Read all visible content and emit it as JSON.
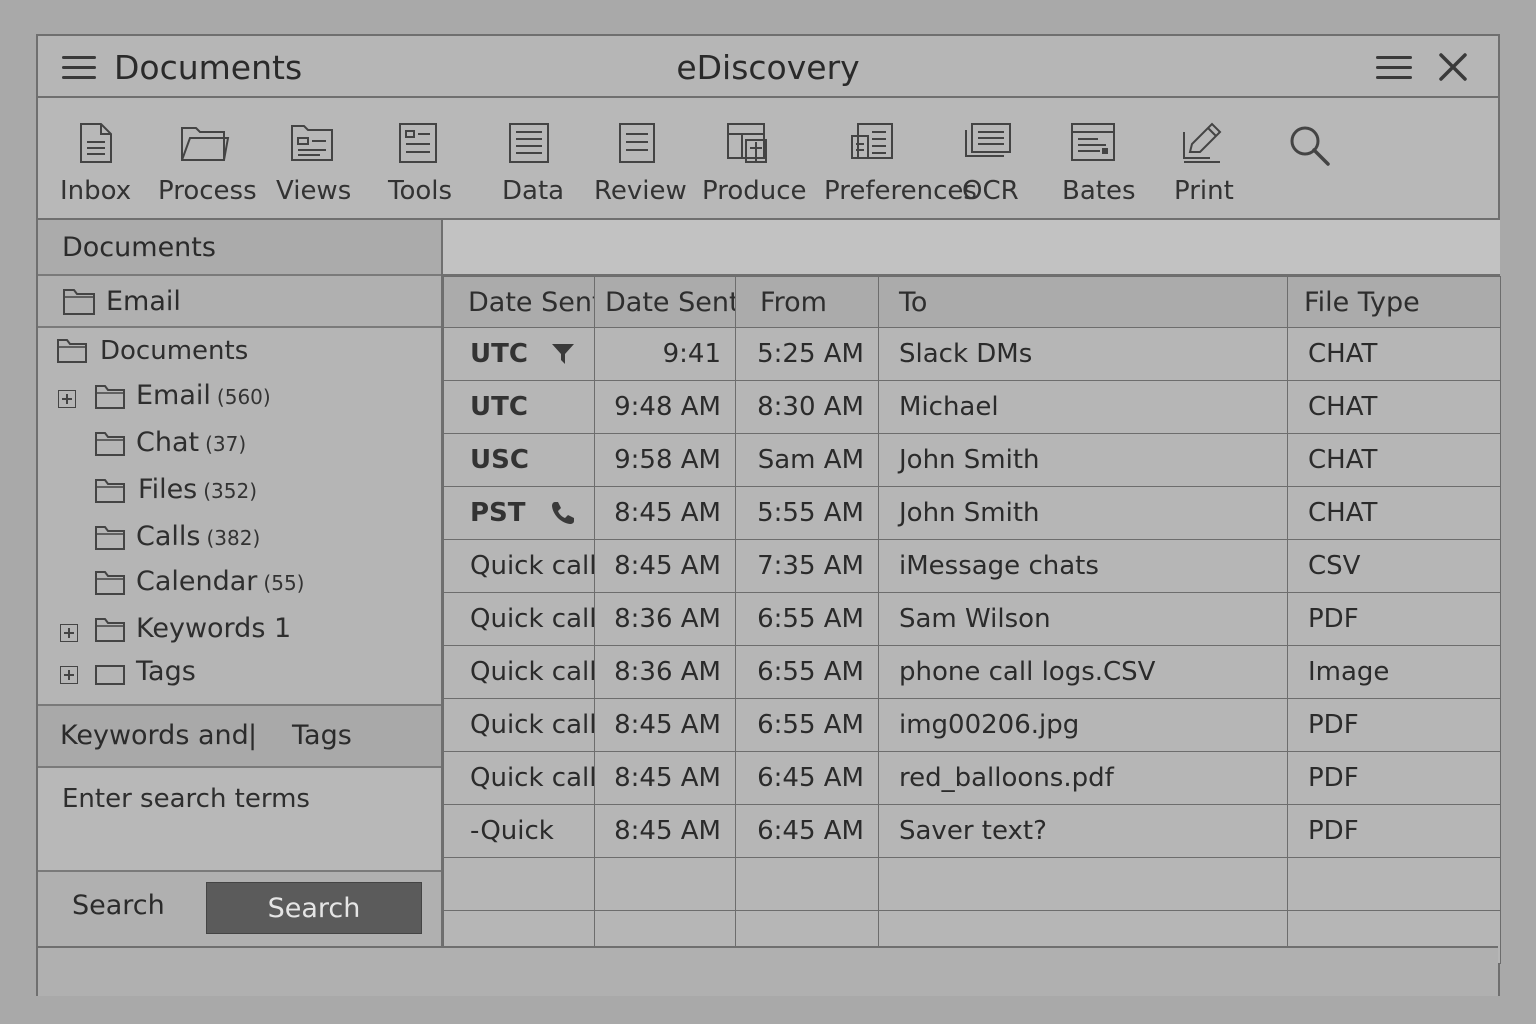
{
  "window": {
    "left_title": "Documents",
    "center_title": "eDiscovery"
  },
  "toolbar": [
    {
      "label": "Inbox",
      "icon": "document-icon"
    },
    {
      "label": "Process",
      "icon": "folder-icon"
    },
    {
      "label": "Views",
      "icon": "views-icon"
    },
    {
      "label": "Tools",
      "icon": "tools-icon"
    },
    {
      "label": "Data",
      "icon": "data-icon"
    },
    {
      "label": "Review",
      "icon": "review-icon"
    },
    {
      "label": "Produce",
      "icon": "produce-icon"
    },
    {
      "label": "Preferences",
      "icon": "preferences-icon"
    },
    {
      "label": "OCR",
      "icon": "ocr-icon"
    },
    {
      "label": "Bates",
      "icon": "bates-icon"
    },
    {
      "label": "Print",
      "icon": "print-icon"
    },
    {
      "label": "",
      "icon": "search-icon"
    }
  ],
  "left": {
    "header": "Documents",
    "email_section": "Email",
    "tree": {
      "root": "Documents",
      "items": [
        {
          "label": "Email",
          "count": "(560)"
        },
        {
          "label": "Chat",
          "count": "(37)"
        },
        {
          "label": "Files",
          "count": "(352)"
        },
        {
          "label": "Calls",
          "count": "(382)"
        },
        {
          "label": "Calendar",
          "count": "(55)"
        },
        {
          "label": "Keywords 1",
          "count": ""
        },
        {
          "label": "Tags",
          "count": ""
        }
      ]
    },
    "keywords_tab": "Keywords and",
    "separator": "|",
    "tags_tab": "Tags",
    "search_placeholder": "Enter search terms",
    "search_label": "Search",
    "search_button": "Search"
  },
  "grid": {
    "columns": [
      "Date Sent",
      "Date Sent",
      "From",
      "To",
      "File Type"
    ],
    "rows": [
      {
        "a": "UTC",
        "b": "9:41",
        "c": "5:25 AM",
        "d": "Slack DMs",
        "e": "CHAT"
      },
      {
        "a": "UTC",
        "b": "9:48 AM",
        "c": "8:30 AM",
        "d": "Michael",
        "e": "CHAT"
      },
      {
        "a": "USC",
        "b": "9:58 AM",
        "c": "Sam AM",
        "d": "John Smith",
        "e": "CHAT"
      },
      {
        "a": "PST",
        "b": "8:45 AM",
        "c": "5:55 AM",
        "d": "John Smith",
        "e": "CHAT"
      },
      {
        "a": "Quick call",
        "b": "8:45 AM",
        "c": "7:35 AM",
        "d": "iMessage chats",
        "e": "CSV"
      },
      {
        "a": "Quick call",
        "b": "8:36 AM",
        "c": "6:55 AM",
        "d": "Sam Wilson",
        "e": "PDF"
      },
      {
        "a": "Quick call",
        "b": "8:36 AM",
        "c": "6:55 AM",
        "d": "phone call logs.CSV",
        "e": "Image"
      },
      {
        "a": "Quick call",
        "b": "8:45 AM",
        "c": "6:55 AM",
        "d": "img00206.jpg",
        "e": "PDF"
      },
      {
        "a": "Quick call",
        "b": "8:45 AM",
        "c": "6:45 AM",
        "d": "red_balloons.pdf",
        "e": "PDF"
      },
      {
        "a": "-Quick",
        "b": "8:45 AM",
        "c": "6:45 AM",
        "d": "Saver text?",
        "e": "PDF"
      }
    ]
  },
  "colors": {
    "background": "#a9a9a9",
    "panel": "#b6b6b6",
    "border": "#6f6f6f",
    "button": "#5b5b5b"
  }
}
